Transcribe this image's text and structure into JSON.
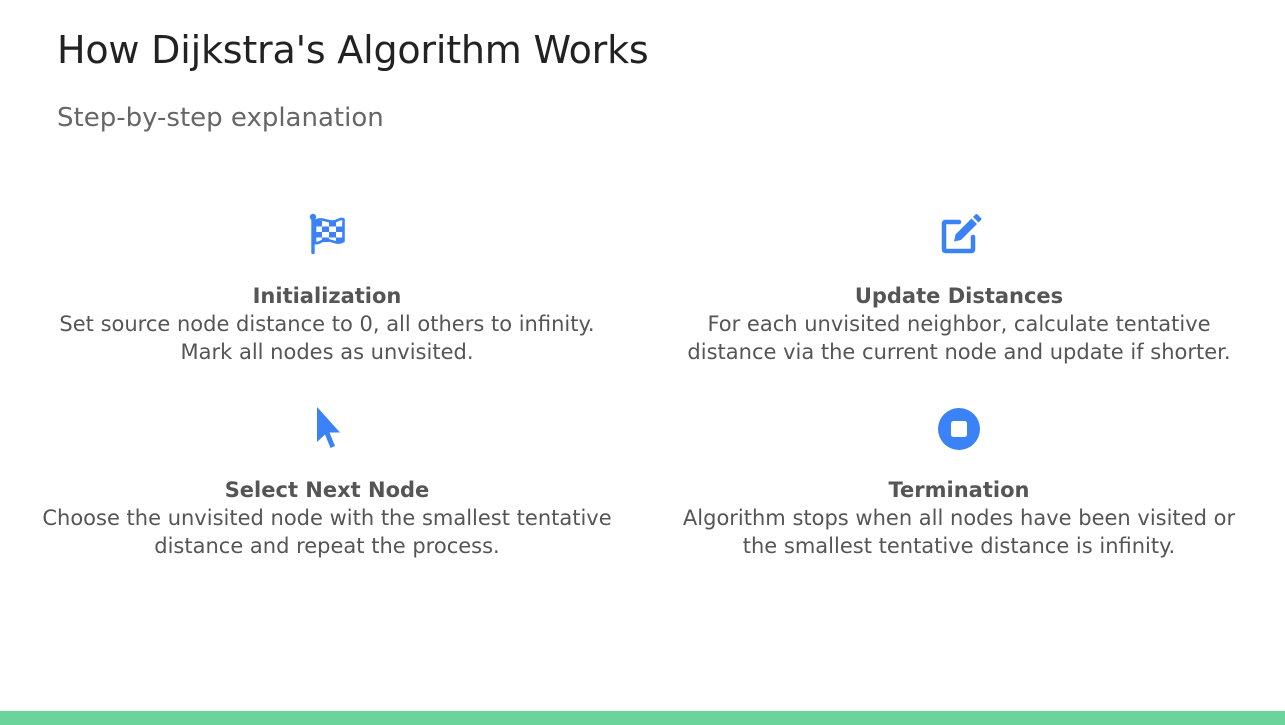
{
  "slide": {
    "title": "How Dijkstra's Algorithm Works",
    "subtitle": "Step-by-step explanation"
  },
  "steps": [
    {
      "icon": "checkered-flag-icon",
      "title": "Initialization",
      "desc_lines": [
        "Set source node distance to 0, all others to infinity.",
        "Mark all nodes as unvisited."
      ]
    },
    {
      "icon": "edit-icon",
      "title": "Update Distances",
      "desc_lines": [
        "For each unvisited neighbor, calculate tentative",
        "distance via the current node and update if shorter."
      ]
    },
    {
      "icon": "mouse-pointer-icon",
      "title": "Select Next Node",
      "desc_lines": [
        "Choose the unvisited node with the smallest tentative",
        "distance and repeat the process."
      ]
    },
    {
      "icon": "stop-circle-icon",
      "title": "Termination",
      "desc_lines": [
        "Algorithm stops when all nodes have been visited or",
        "the smallest tentative distance is infinity."
      ]
    }
  ],
  "colors": {
    "accent": "#3b82f6",
    "footer": "#6ad49a"
  }
}
